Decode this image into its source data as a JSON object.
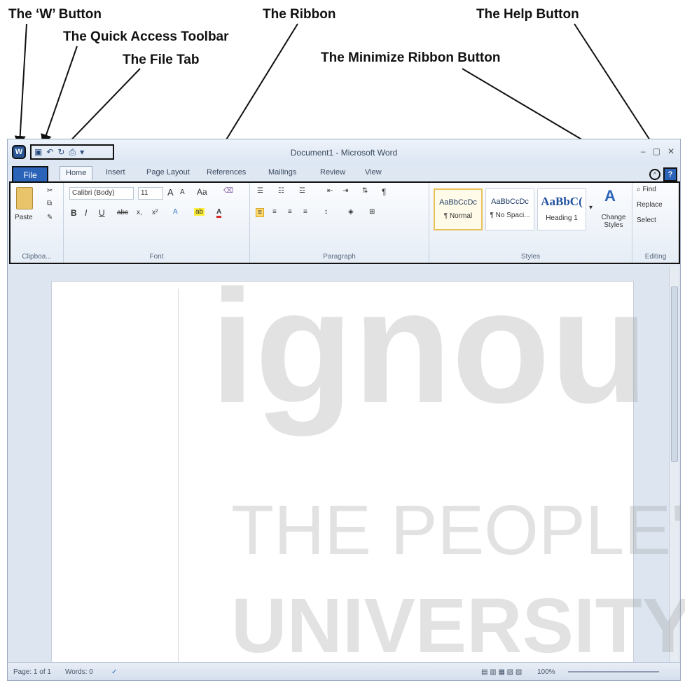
{
  "annotations": {
    "w_button": "The ‘W’ Button",
    "quick_access": "The Quick Access Toolbar",
    "file_tab": "The File Tab",
    "ribbon": "The Ribbon",
    "help": "The Help Button",
    "minimize": "The Minimize Ribbon Button"
  },
  "window": {
    "title": "Document1 - Microsoft Word",
    "w_icon_label": "W"
  },
  "tabs": {
    "file": "File",
    "home": "Home",
    "insert": "Insert",
    "page_layout": "Page Layout",
    "references": "References",
    "mailings": "Mailings",
    "review": "Review",
    "view": "View"
  },
  "ribbon": {
    "clipboard": {
      "paste": "Paste",
      "label": "Clipboa..."
    },
    "font": {
      "name": "Calibri (Body)",
      "size": "11",
      "grow": "A",
      "shrink": "A",
      "case": "Aa",
      "bold": "B",
      "italic": "I",
      "underline": "U",
      "strike": "abc",
      "sub": "x,",
      "sup": "x²",
      "label": "Font"
    },
    "paragraph": {
      "label": "Paragraph",
      "pilcrow": "¶"
    },
    "styles": {
      "items": [
        {
          "preview": "AaBbCcDc",
          "name": "¶ Normal"
        },
        {
          "preview": "AaBbCcDc",
          "name": "¶ No Spaci..."
        },
        {
          "preview": "AaBbC(",
          "name": "Heading 1"
        }
      ],
      "change_styles": "Change Styles",
      "label": "Styles"
    },
    "editing": {
      "find": "Find",
      "replace": "Replace",
      "select": "Select",
      "label": "Editing"
    }
  },
  "status": {
    "page": "Page: 1 of 1",
    "words": "Words: 0",
    "zoom": "100%"
  },
  "watermark": {
    "line1": "ignou",
    "line2": "THE PEOPLE'S",
    "line3": "UNIVERSITY"
  }
}
